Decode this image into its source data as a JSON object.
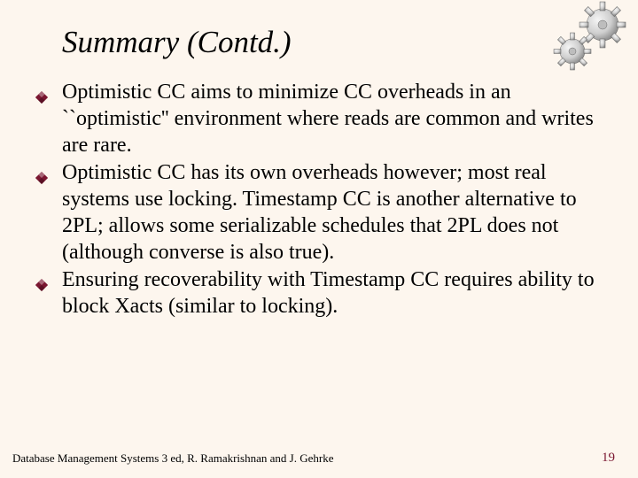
{
  "title": "Summary (Contd.)",
  "bullets": [
    "Optimistic CC aims to minimize CC overheads in an ``optimistic'' environment where reads are common and writes are rare.",
    "Optimistic CC has its own overheads however; most real systems use locking. Timestamp CC is another alternative to 2PL; allows some serializable schedules that 2PL does not (although converse is also true).",
    "Ensuring recoverability with Timestamp CC requires ability to block Xacts (similar to locking)."
  ],
  "footer": "Database Management Systems 3 ed,  R. Ramakrishnan and J. Gehrke",
  "page_number": "19",
  "bullet_color": "#7a1630"
}
